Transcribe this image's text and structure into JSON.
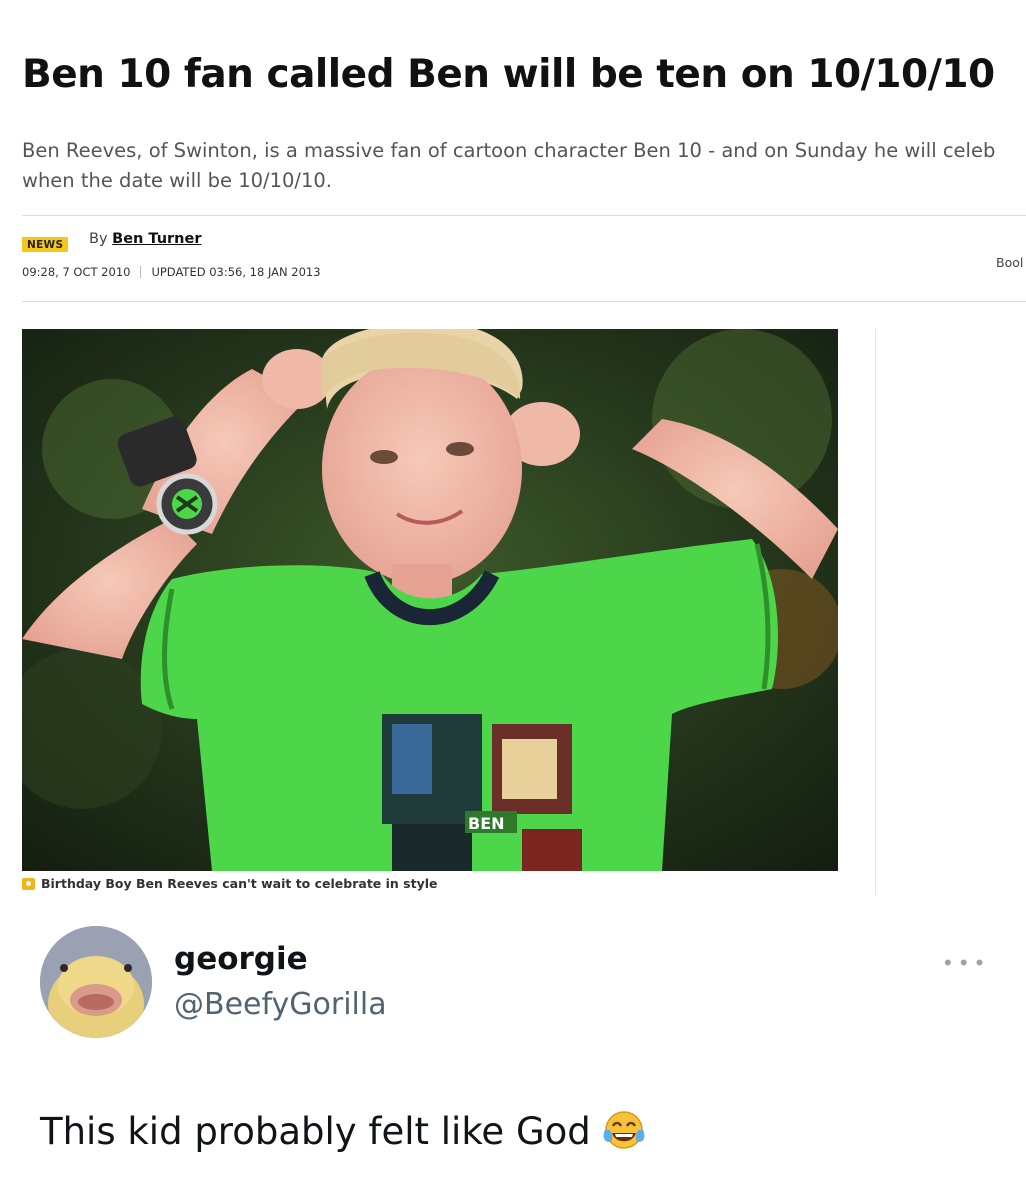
{
  "article": {
    "headline": "Ben 10 fan called Ben will be ten on 10/10/10",
    "standfirst_line1": "Ben Reeves, of Swinton, is a massive fan of cartoon character Ben 10 - and on Sunday he will celeb",
    "standfirst_line2": "when the date will be 10/10/10.",
    "section_badge": "NEWS",
    "byline_prefix": "By",
    "author": "Ben Turner",
    "published": "09:28, 7 OCT 2010",
    "updated": "UPDATED 03:56, 18 JAN 2013",
    "bookmark_label": "Bool",
    "photo_shirt_text": "BEN",
    "photo_caption": "Birthday Boy Ben Reeves can't wait to celebrate in style",
    "caption_icon": "camera-icon"
  },
  "tweet": {
    "name": "georgie",
    "handle": "@BeefyGorilla",
    "more_icon": "more-options-icon",
    "text": "This kid probably felt like God",
    "emoji": "face-with-tears-of-joy"
  },
  "colors": {
    "badge": "#f7c71c",
    "shirt": "#4dd64a",
    "handle": "#536471"
  }
}
